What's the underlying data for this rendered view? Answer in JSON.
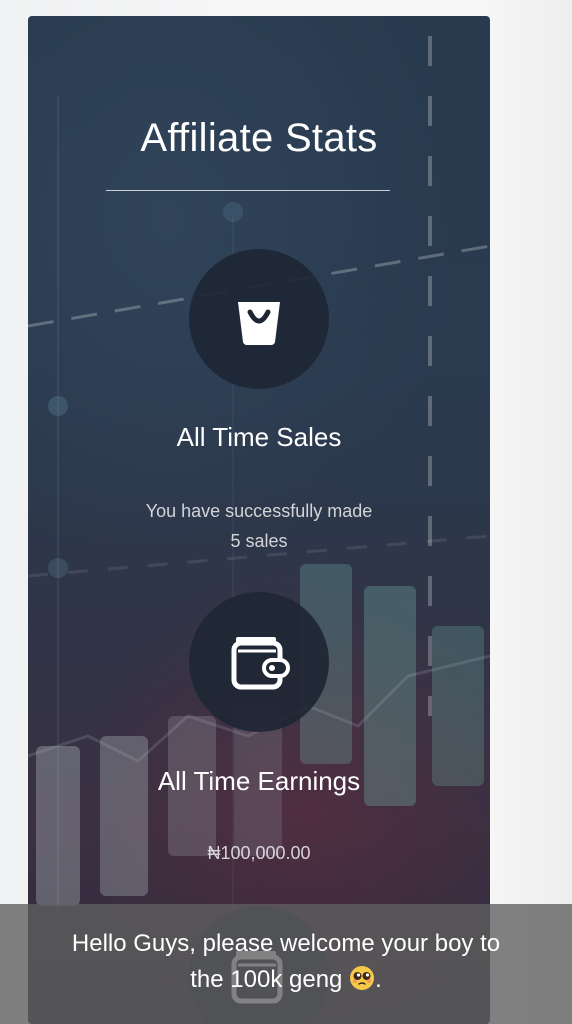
{
  "affiliate": {
    "title": "Affiliate Stats",
    "sales": {
      "icon": "shopping-bag-icon",
      "heading": "All Time Sales",
      "line1": "You have successfully made",
      "line2": "5 sales"
    },
    "earnings": {
      "icon": "wallet-icon",
      "heading": "All Time Earnings",
      "amount": "₦100,000.00"
    },
    "next": {
      "icon": "wallet-icon"
    }
  },
  "caption": {
    "line1": "Hello Guys, please welcome your boy to",
    "line2": "the 100k geng",
    "line2_end": ".",
    "emoji": "pleading-face-emoji"
  },
  "colors": {
    "card_background": "#2a3a4f",
    "icon_circle": "#1e2634",
    "caption_bar": "#5f5f5f"
  }
}
